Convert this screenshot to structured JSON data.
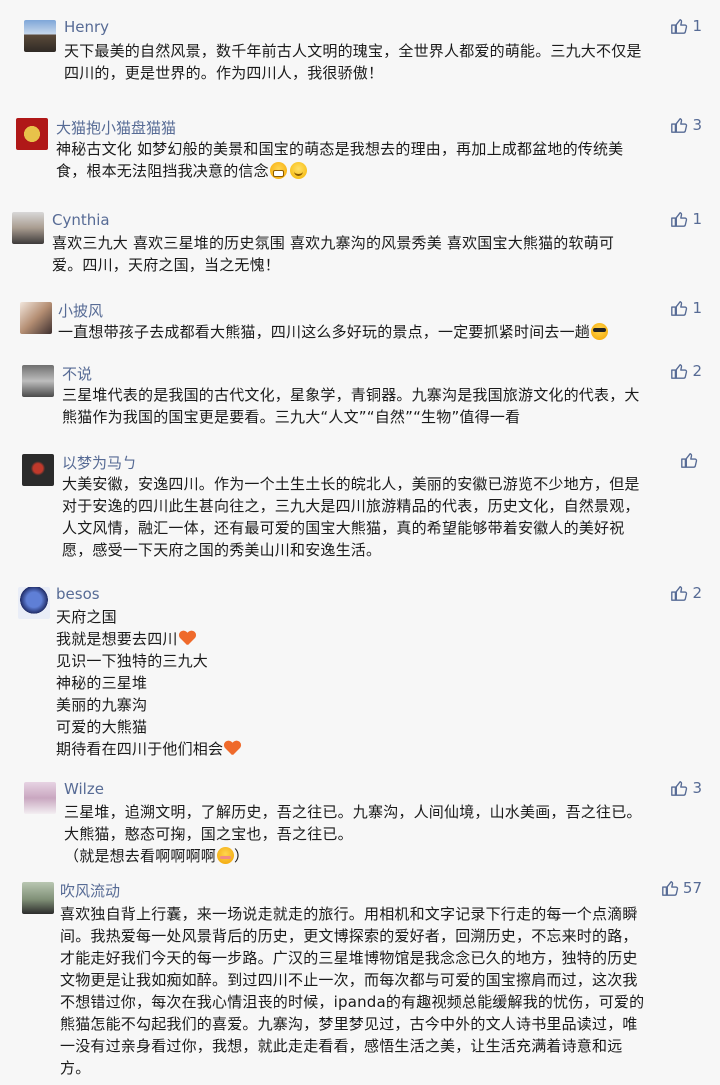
{
  "like_icon": "thumbs-up-icon",
  "accent_color": "#576b95",
  "comments": [
    {
      "name": "Henry",
      "likes": "1",
      "lines": [
        "天下最美的自然风景，数千年前古人文明的瑰宝，全世界人都爱的萌能。三九大不仅是",
        "四川的，更是世界的。作为四川人，我很骄傲！"
      ]
    },
    {
      "name": "大猫抱小猫盘猫猫",
      "likes": "3",
      "lines": [
        "神秘古文化 如梦幻般的美景和国宝的萌态是我想去的理由，再加上成都盆地的传统美",
        "食，根本无法阻挡我决意的信念"
      ]
    },
    {
      "name": "Cynthia",
      "likes": "1",
      "lines": [
        "喜欢三九大 喜欢三星堆的历史氛围 喜欢九寨沟的风景秀美 喜欢国宝大熊猫的软萌可",
        "爱。四川，天府之国，当之无愧！"
      ]
    },
    {
      "name": "小披风",
      "likes": "1",
      "lines": [
        "一直想带孩子去成都看大熊猫，四川这么多好玩的景点，一定要抓紧时间去一趟"
      ]
    },
    {
      "name": "不说",
      "likes": "2",
      "lines": [
        "三星堆代表的是我国的古代文化，星象学，青铜器。九寨沟是我国旅游文化的代表，大",
        "熊猫作为我国的国宝更是要看。三九大“人文”“自然”“生物”值得一看"
      ]
    },
    {
      "name": "以梦为马ㄅ",
      "likes": "",
      "lines": [
        "大美安徽，安逸四川。作为一个土生土长的皖北人，美丽的安徽已游览不少地方，但是",
        "对于安逸的四川此生甚向往之，三九大是四川旅游精品的代表，历史文化，自然景观，",
        "人文风情，融汇一体，还有最可爱的国宝大熊猫，真的希望能够带着安徽人的美好祝",
        "愿，感受一下天府之国的秀美山川和安逸生活。"
      ]
    },
    {
      "name": "besos",
      "likes": "2",
      "lines": [
        "天府之国",
        "我就是想要去四川",
        "见识一下独特的三九大",
        "神秘的三星堆",
        "美丽的九寨沟",
        "可爱的大熊猫",
        "期待看在四川于他们相会"
      ]
    },
    {
      "name": "Wilze",
      "likes": "3",
      "lines": [
        "三星堆，追溯文明，了解历史，吾之往已。九寨沟，人间仙境，山水美画，吾之往已。",
        "大熊猫，憨态可掬，国之宝也，吾之往已。",
        "（就是想去看啊啊啊啊",
        "）"
      ]
    },
    {
      "name": "吹风流动",
      "likes": "57",
      "lines": [
        "喜欢独自背上行囊，来一场说走就走的旅行。用相机和文字记录下行走的每一个点滴瞬",
        "间。我热爱每一处风景背后的历史，更文博探索的爱好者，回溯历史，不忘来时的路，",
        "才能走好我们今天的每一步路。广汉的三星堆博物馆是我念念已久的地方，独特的历史",
        "文物更是让我如痴如醉。到过四川不止一次，而每次都与可爱的国宝擦肩而过，这次我",
        "不想错过你，每次在我心情沮丧的时候，ipanda的有趣视频总能缓解我的忧伤，可爱的",
        "熊猫怎能不勾起我们的喜爱。九寨沟，梦里梦见过，古今中外的文人诗书里品读过，唯",
        "一没有过亲身看过你，我想，就此走走看看，感悟生活之美，让生活充满着诗意和远",
        "方。"
      ]
    }
  ]
}
